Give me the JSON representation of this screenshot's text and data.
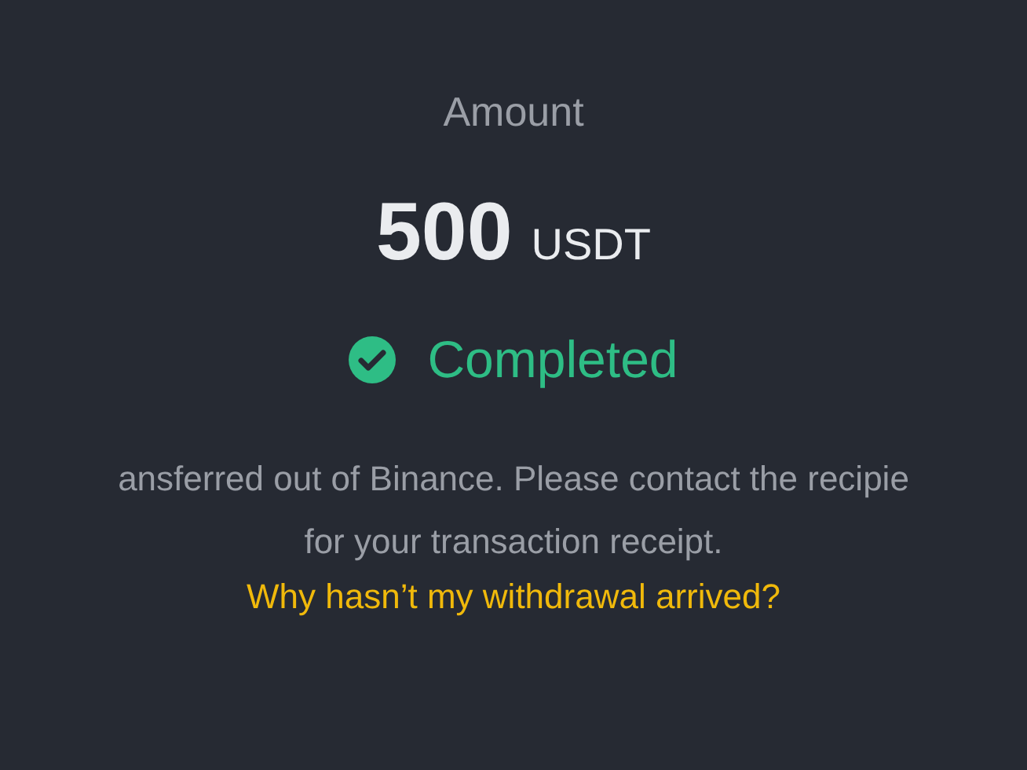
{
  "amount": {
    "label": "Amount",
    "value": "500",
    "unit": "USDT"
  },
  "status": {
    "completed": true,
    "label": "Completed"
  },
  "message": {
    "lines": [
      "ansferred out of Binance. Please contact the recipie",
      "for your transaction receipt."
    ]
  },
  "help_link": "Why hasn’t my withdrawal arrived?"
}
